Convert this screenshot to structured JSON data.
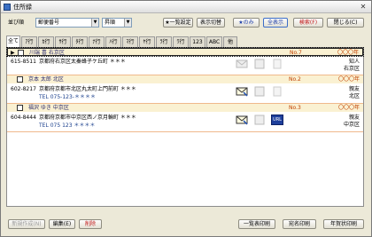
{
  "window": {
    "title": "住所録"
  },
  "toolbar": {
    "sort_label": "並び順",
    "sort_value": "郵便番号",
    "order_value": "昇順",
    "settings_button": "★一覧設定",
    "view_toggle_button": "表示切替",
    "star_button": "★のみ",
    "show_all_button": "全表示",
    "search_button": "検索(F)",
    "close_button": "閉じる(C)"
  },
  "tabs": [
    "全て",
    "ｱ行",
    "ｶ行",
    "ｻ行",
    "ﾀ行",
    "ﾅ行",
    "ﾊ行",
    "ﾏ行",
    "ﾔ行",
    "ﾗ行",
    "ﾜ行",
    "123",
    "ABC",
    "他"
  ],
  "records": [
    {
      "name": "川端 喜 右京区",
      "no": "No.7",
      "tag": "〇〇〇年",
      "postal": "615-8511",
      "address": "京都府右京区太秦蜂子ケ丘町 ＊＊＊",
      "tel": "",
      "group": "知人",
      "area": "右京区",
      "email_icon": "none",
      "note_icon": "none"
    },
    {
      "name": "京本 太郎 北区",
      "no": "No.2",
      "tag": "〇〇〇年",
      "postal": "602-8217",
      "address": "京都府京都市北区丸太町上門前町 ＊＊＊",
      "tel": "TEL 075-123-＊＊＊＊",
      "group": "親友",
      "area": "北区",
      "email_icon": "envelope",
      "note_icon": "none"
    },
    {
      "name": "福沢 ゆき 中京区",
      "no": "No.3",
      "tag": "〇〇〇年",
      "postal": "604-8444",
      "address": "京都府京都市中京区西ノ京月輪町 ＊＊＊",
      "tel": "TEL 075 123 ＊＊＊＊",
      "group": "親友",
      "area": "中京区",
      "email_icon": "envelope",
      "note_icon": "url",
      "url_label": "URL"
    }
  ],
  "bottom": {
    "new_button": "新規作成(N)",
    "edit_button": "編集(E)",
    "delete_button": "削除",
    "print_list_button": "一覧表印刷",
    "envelope_print_button": "宛名印刷",
    "card_print_button": "年賀状印刷"
  }
}
